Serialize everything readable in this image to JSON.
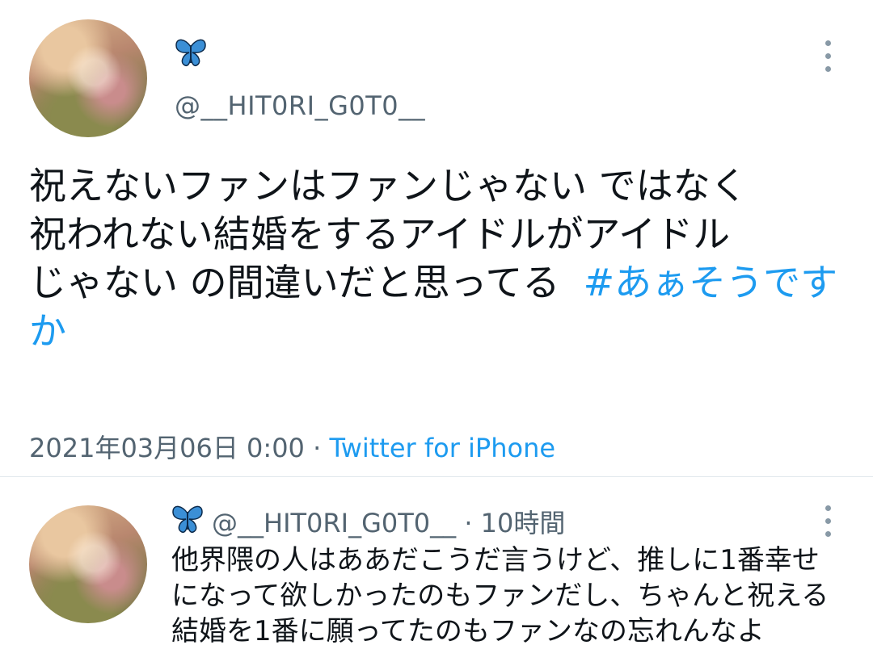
{
  "colors": {
    "link": "#1d9bf0",
    "secondary": "#536471",
    "text": "#0f1419",
    "icon": "#8899a6"
  },
  "main_tweet": {
    "avatar_icon": "profile-avatar",
    "display_icon": "butterfly-icon",
    "handle": "@__HIT0RI_G0T0__",
    "text_line1": "祝えないファンはファンじゃない ではなく",
    "text_line2": "祝われない結婚をするアイドルがアイドル",
    "text_line3": "じゃない の間違いだと思ってる",
    "hashtag": "#あぁそうですか",
    "timestamp": "2021年03月06日 0:00",
    "separator": "·",
    "source": "Twitter for iPhone",
    "menu_icon": "more-vertical-icon"
  },
  "reply": {
    "avatar_icon": "profile-avatar",
    "display_icon": "butterfly-icon",
    "handle": "@__HIT0RI_G0T0__",
    "separator": "·",
    "time": "10時間",
    "text_line1": "他界隈の人はああだこうだ言うけど、推しに1番幸せ",
    "text_line2": "になって欲しかったのもファンだし、ちゃんと祝える",
    "text_line3": "結婚を1番に願ってたのもファンなの忘れんなよ",
    "menu_icon": "more-vertical-icon"
  }
}
